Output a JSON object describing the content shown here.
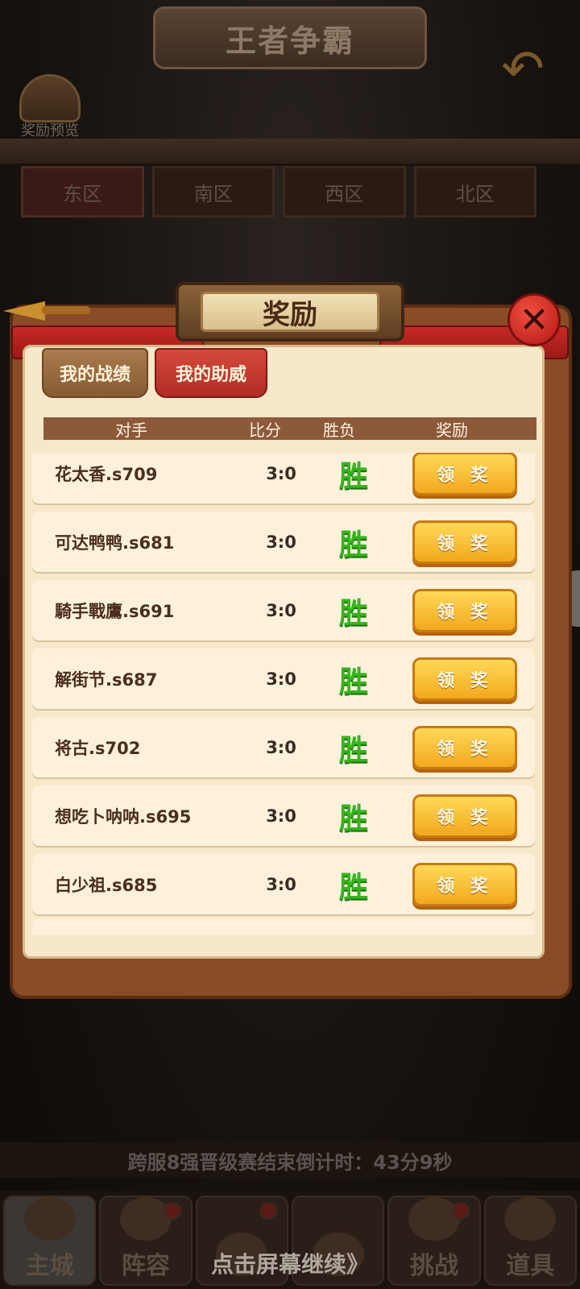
{
  "header": {
    "title": "王者争霸",
    "reward_preview_label": "奖励预览"
  },
  "zones": [
    "东区",
    "南区",
    "西区",
    "北区"
  ],
  "modal": {
    "title": "奖励",
    "tabs": [
      {
        "label": "我的战绩",
        "active": false
      },
      {
        "label": "我的助威",
        "active": true
      }
    ],
    "columns": {
      "opponent": "对手",
      "score": "比分",
      "result": "胜负",
      "reward": "奖励"
    },
    "rows": [
      {
        "opponent": "花太香.s709",
        "score": "3:0",
        "result": "胜",
        "button": "领 奖"
      },
      {
        "opponent": "可达鸭鸭.s681",
        "score": "3:0",
        "result": "胜",
        "button": "领 奖"
      },
      {
        "opponent": "騎手戰鷹.s691",
        "score": "3:0",
        "result": "胜",
        "button": "领 奖"
      },
      {
        "opponent": "解街节.s687",
        "score": "3:0",
        "result": "胜",
        "button": "领 奖"
      },
      {
        "opponent": "将古.s702",
        "score": "3:0",
        "result": "胜",
        "button": "领 奖"
      },
      {
        "opponent": "想吃卜呐呐.s695",
        "score": "3:0",
        "result": "胜",
        "button": "领 奖"
      },
      {
        "opponent": "白少祖.s685",
        "score": "3:0",
        "result": "胜",
        "button": "领 奖"
      }
    ]
  },
  "countdown": "跨服8强晋级赛结束倒计时：43分9秒",
  "tap_to_continue": "点击屏幕继续》",
  "nav": [
    {
      "label": "主城",
      "active": true,
      "dot": false
    },
    {
      "label": "阵容",
      "active": false,
      "dot": true
    },
    {
      "label": "",
      "active": false,
      "dot": true
    },
    {
      "label": "",
      "active": false,
      "dot": false
    },
    {
      "label": "挑战",
      "active": false,
      "dot": true
    },
    {
      "label": "道具",
      "active": false,
      "dot": false
    }
  ],
  "colors": {
    "win_green": "#36b41f",
    "claim_gold": "#f2a81e",
    "tab_active_red": "#d54a3d"
  }
}
